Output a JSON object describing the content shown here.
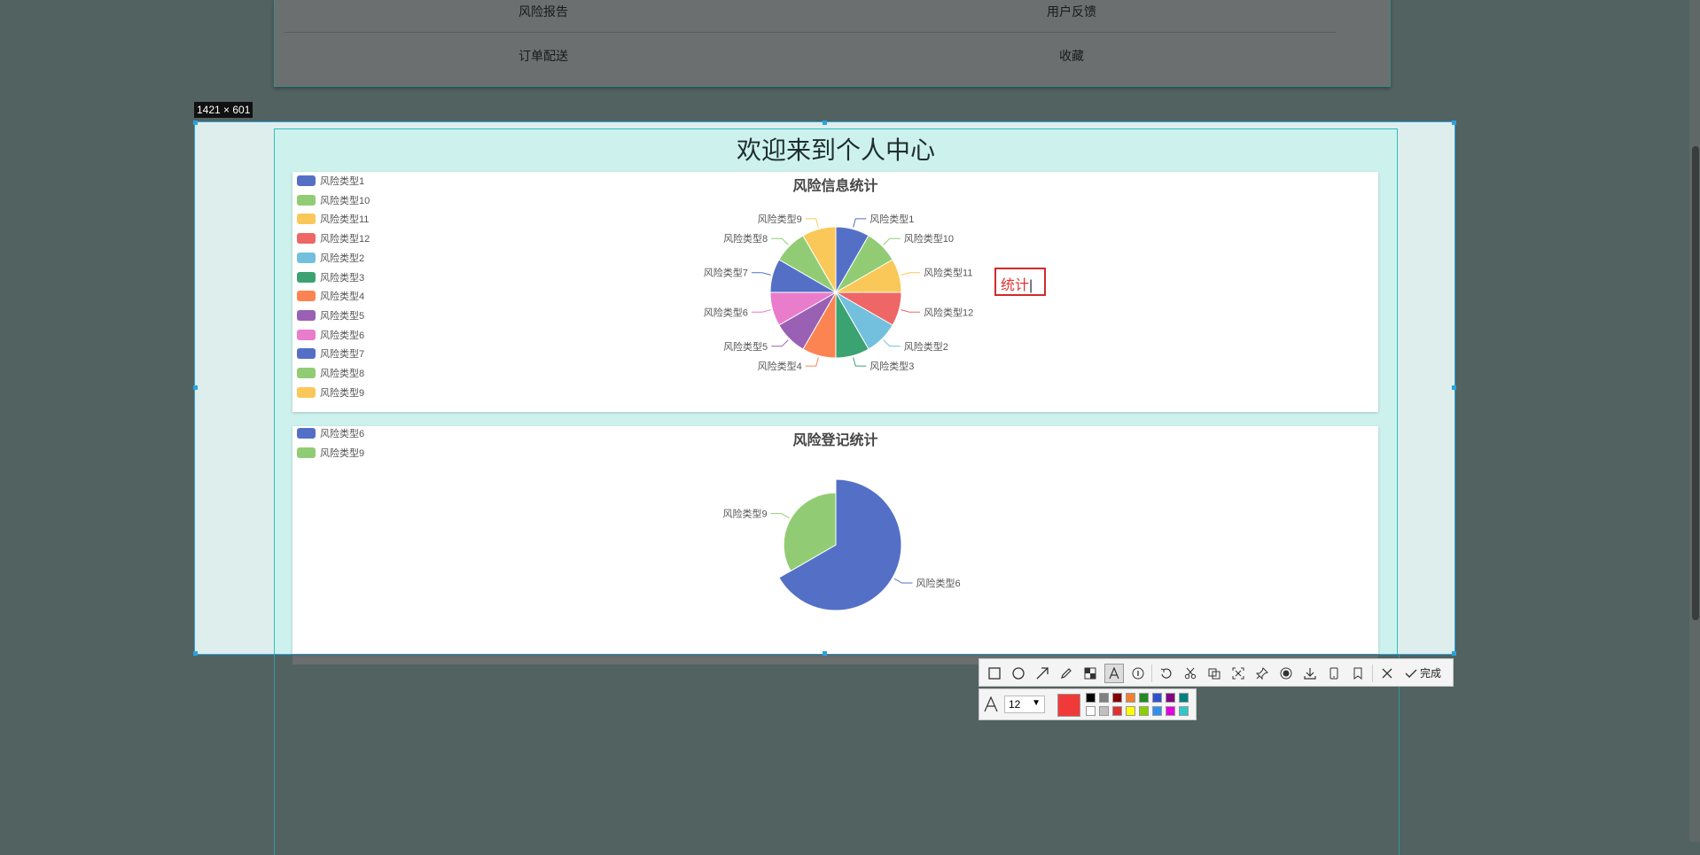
{
  "menu": {
    "items": [
      {
        "label": "风险报告"
      },
      {
        "label": "用户反馈"
      },
      {
        "label": "订单配送"
      },
      {
        "label": "收藏"
      }
    ]
  },
  "selection": {
    "size_label": "1421 × 601"
  },
  "page": {
    "title": "欢迎来到个人中心"
  },
  "annotation": {
    "text": "统计"
  },
  "toolbar": {
    "tools": [
      "rectangle-icon",
      "ellipse-icon",
      "arrow-icon",
      "pen-icon",
      "mosaic-icon",
      "text-icon",
      "number-marker-icon",
      "undo-icon",
      "scissors-icon",
      "ocr-icon",
      "scroll-capture-icon",
      "pin-icon",
      "record-icon",
      "save-icon",
      "phone-icon",
      "bookmark-icon",
      "cancel-icon"
    ],
    "done_label": "完成"
  },
  "text_options": {
    "font_size": "12",
    "current_color": "#f03a3a",
    "palette_top": [
      "#000000",
      "#808080",
      "#800000",
      "#f08030",
      "#228b22",
      "#3050d0",
      "#800080",
      "#008080"
    ],
    "palette_bottom": [
      "#ffffff",
      "#c0c0c0",
      "#e03030",
      "#ffff00",
      "#8ad000",
      "#3090f0",
      "#e000e0",
      "#30c8c8"
    ]
  },
  "chart_data": [
    {
      "type": "pie",
      "title": "风险信息统计",
      "legend": [
        "风险类型1",
        "风险类型10",
        "风险类型11",
        "风险类型12",
        "风险类型2",
        "风险类型3",
        "风险类型4",
        "风险类型5",
        "风险类型6",
        "风险类型7",
        "风险类型8",
        "风险类型9"
      ],
      "colors": [
        "#5470c6",
        "#91cc75",
        "#fac858",
        "#ee6666",
        "#73c0de",
        "#3ba272",
        "#fc8452",
        "#9a60b4",
        "#ea7ccc",
        "#5470c6",
        "#91cc75",
        "#fac858"
      ],
      "values": [
        1,
        1,
        1,
        1,
        1,
        1,
        1,
        1,
        1,
        1,
        1,
        1
      ],
      "legend_position": "left"
    },
    {
      "type": "pie",
      "title": "风险登记统计",
      "legend": [
        "风险类型6",
        "风险类型9"
      ],
      "colors": [
        "#5470c6",
        "#91cc75"
      ],
      "values": [
        2,
        1
      ],
      "rose": true,
      "legend_position": "left"
    }
  ]
}
